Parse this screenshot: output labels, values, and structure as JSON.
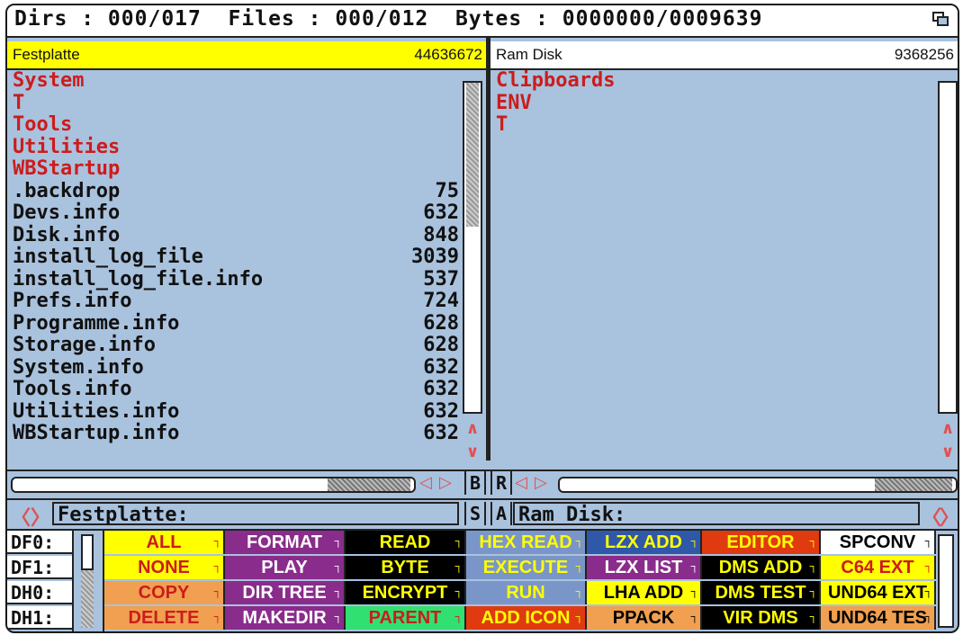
{
  "title_bar": {
    "text": "Dirs : 000/017  Files : 000/012  Bytes : 0000000/0009639"
  },
  "left_pane": {
    "name": "Festplatte",
    "free": "44636672",
    "path": "Festplatte:",
    "entries": [
      {
        "name": "System",
        "size": "",
        "type": "dir"
      },
      {
        "name": "T",
        "size": "",
        "type": "dir"
      },
      {
        "name": "Tools",
        "size": "",
        "type": "dir"
      },
      {
        "name": "Utilities",
        "size": "",
        "type": "dir"
      },
      {
        "name": "WBStartup",
        "size": "",
        "type": "dir"
      },
      {
        "name": ".backdrop",
        "size": "75",
        "type": "file"
      },
      {
        "name": "Devs.info",
        "size": "632",
        "type": "file"
      },
      {
        "name": "Disk.info",
        "size": "848",
        "type": "file"
      },
      {
        "name": "install_log_file",
        "size": "3039",
        "type": "file"
      },
      {
        "name": "install_log_file.info",
        "size": "537",
        "type": "file"
      },
      {
        "name": "Prefs.info",
        "size": "724",
        "type": "file"
      },
      {
        "name": "Programme.info",
        "size": "628",
        "type": "file"
      },
      {
        "name": "Storage.info",
        "size": "628",
        "type": "file"
      },
      {
        "name": "System.info",
        "size": "632",
        "type": "file"
      },
      {
        "name": "Tools.info",
        "size": "632",
        "type": "file"
      },
      {
        "name": "Utilities.info",
        "size": "632",
        "type": "file"
      },
      {
        "name": "WBStartup.info",
        "size": "632",
        "type": "file"
      }
    ]
  },
  "right_pane": {
    "name": "Ram Disk",
    "free": "9368256",
    "path": "Ram Disk:",
    "entries": [
      {
        "name": "Clipboards",
        "size": "",
        "type": "dir"
      },
      {
        "name": "ENV",
        "size": "",
        "type": "dir"
      },
      {
        "name": "T",
        "size": "",
        "type": "dir"
      }
    ]
  },
  "mid_letters": {
    "b": "B",
    "r": "R",
    "s": "S",
    "a": "A"
  },
  "devices": [
    "DF0:",
    "DF1:",
    "DH0:",
    "DH1:"
  ],
  "buttons": [
    [
      {
        "label": "ALL",
        "bg": "#ffff00",
        "fg": "#cc1c1c"
      },
      {
        "label": "FORMAT",
        "bg": "#8a2c8c",
        "fg": "#ffffff"
      },
      {
        "label": "READ",
        "bg": "#000000",
        "fg": "#ffff00"
      },
      {
        "label": "HEX READ",
        "bg": "#7a96c8",
        "fg": "#ffff00"
      },
      {
        "label": "LZX ADD",
        "bg": "#3058a8",
        "fg": "#ffff00"
      },
      {
        "label": "EDITOR",
        "bg": "#e03a10",
        "fg": "#ffff00"
      },
      {
        "label": "SPCONV",
        "bg": "#ffffff",
        "fg": "#000000"
      }
    ],
    [
      {
        "label": "NONE",
        "bg": "#ffff00",
        "fg": "#cc1c1c"
      },
      {
        "label": "PLAY",
        "bg": "#8a2c8c",
        "fg": "#ffffff"
      },
      {
        "label": "BYTE",
        "bg": "#000000",
        "fg": "#ffff00"
      },
      {
        "label": "EXECUTE",
        "bg": "#7a96c8",
        "fg": "#ffff00"
      },
      {
        "label": "LZX LIST",
        "bg": "#8a2c8c",
        "fg": "#ffffff"
      },
      {
        "label": "DMS ADD",
        "bg": "#000000",
        "fg": "#ffff00"
      },
      {
        "label": "C64 EXT",
        "bg": "#ffff00",
        "fg": "#cc1c1c"
      }
    ],
    [
      {
        "label": "COPY",
        "bg": "#f0a050",
        "fg": "#cc1c1c"
      },
      {
        "label": "DIR TREE",
        "bg": "#8a2c8c",
        "fg": "#ffffff"
      },
      {
        "label": "ENCRYPT",
        "bg": "#000000",
        "fg": "#ffff00"
      },
      {
        "label": "RUN",
        "bg": "#7a96c8",
        "fg": "#ffff00"
      },
      {
        "label": "LHA ADD",
        "bg": "#ffff00",
        "fg": "#000000"
      },
      {
        "label": "DMS TEST",
        "bg": "#000000",
        "fg": "#ffff00"
      },
      {
        "label": "UND64 EXT",
        "bg": "#ffff00",
        "fg": "#000000"
      }
    ],
    [
      {
        "label": "DELETE",
        "bg": "#f0a050",
        "fg": "#cc1c1c"
      },
      {
        "label": "MAKEDIR",
        "bg": "#8a2c8c",
        "fg": "#ffffff"
      },
      {
        "label": "PARENT",
        "bg": "#30e070",
        "fg": "#cc1c1c"
      },
      {
        "label": "ADD ICON",
        "bg": "#e03a10",
        "fg": "#ffff00"
      },
      {
        "label": "PPACK",
        "bg": "#f0a050",
        "fg": "#000000"
      },
      {
        "label": "VIR DMS",
        "bg": "#000000",
        "fg": "#ffff00"
      },
      {
        "label": "UND64 TES",
        "bg": "#f0a050",
        "fg": "#000000"
      }
    ]
  ]
}
